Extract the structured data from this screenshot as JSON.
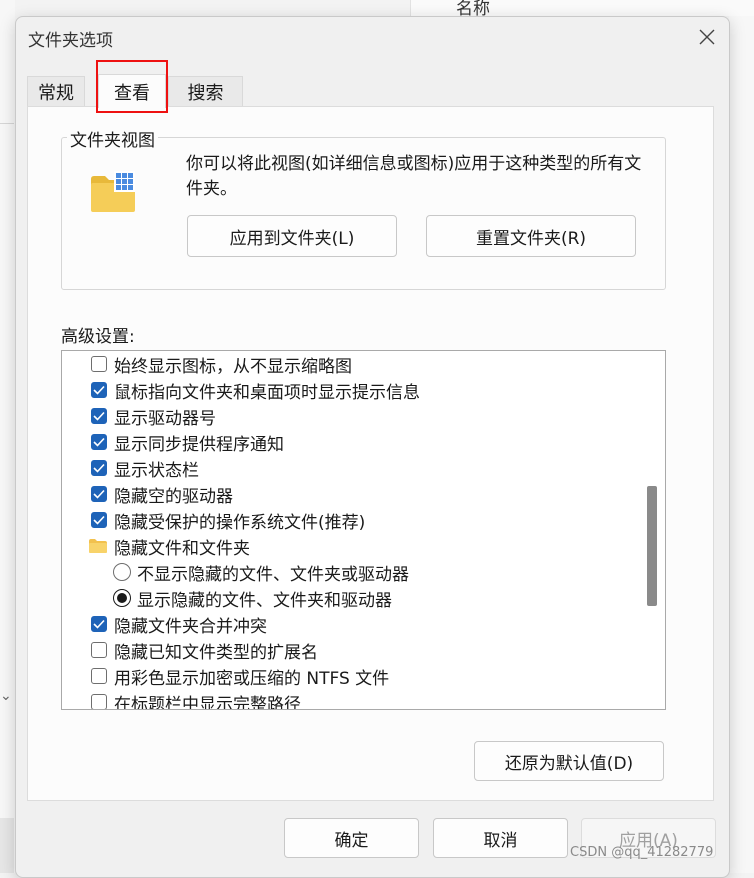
{
  "background": {
    "header_text": "名称",
    "chevron": "⌄"
  },
  "dialog": {
    "title": "文件夹选项",
    "close_icon": "close-icon",
    "tabs": [
      {
        "label": "常规"
      },
      {
        "label": "查看"
      },
      {
        "label": "搜索"
      }
    ],
    "folder_view": {
      "group_title": "文件夹视图",
      "description": "你可以将此视图(如详细信息或图标)应用于这种类型的所有文件夹。",
      "apply_button": "应用到文件夹(L)",
      "reset_button": "重置文件夹(R)"
    },
    "advanced": {
      "label": "高级设置:",
      "items": [
        {
          "type": "checkbox",
          "checked": false,
          "label": "始终显示图标，从不显示缩略图"
        },
        {
          "type": "checkbox",
          "checked": true,
          "label": "鼠标指向文件夹和桌面项时显示提示信息"
        },
        {
          "type": "checkbox",
          "checked": true,
          "label": "显示驱动器号"
        },
        {
          "type": "checkbox",
          "checked": true,
          "label": "显示同步提供程序通知"
        },
        {
          "type": "checkbox",
          "checked": true,
          "label": "显示状态栏"
        },
        {
          "type": "checkbox",
          "checked": true,
          "label": "隐藏空的驱动器"
        },
        {
          "type": "checkbox",
          "checked": true,
          "label": "隐藏受保护的操作系统文件(推荐)"
        },
        {
          "type": "folder",
          "label": "隐藏文件和文件夹"
        },
        {
          "type": "radio",
          "checked": false,
          "label": "不显示隐藏的文件、文件夹或驱动器"
        },
        {
          "type": "radio",
          "checked": true,
          "label": "显示隐藏的文件、文件夹和驱动器"
        },
        {
          "type": "checkbox",
          "checked": true,
          "label": "隐藏文件夹合并冲突"
        },
        {
          "type": "checkbox",
          "checked": false,
          "label": "隐藏已知文件类型的扩展名"
        },
        {
          "type": "checkbox",
          "checked": false,
          "label": "用彩色显示加密或压缩的 NTFS 文件"
        },
        {
          "type": "checkbox",
          "checked": false,
          "label": "在标题栏中显示完整路径"
        }
      ],
      "restore_button": "还原为默认值(D)"
    },
    "footer": {
      "ok": "确定",
      "cancel": "取消",
      "apply": "应用(A)"
    },
    "accent_color": "#1e63b8"
  },
  "watermark": "CSDN @qq_41282779"
}
